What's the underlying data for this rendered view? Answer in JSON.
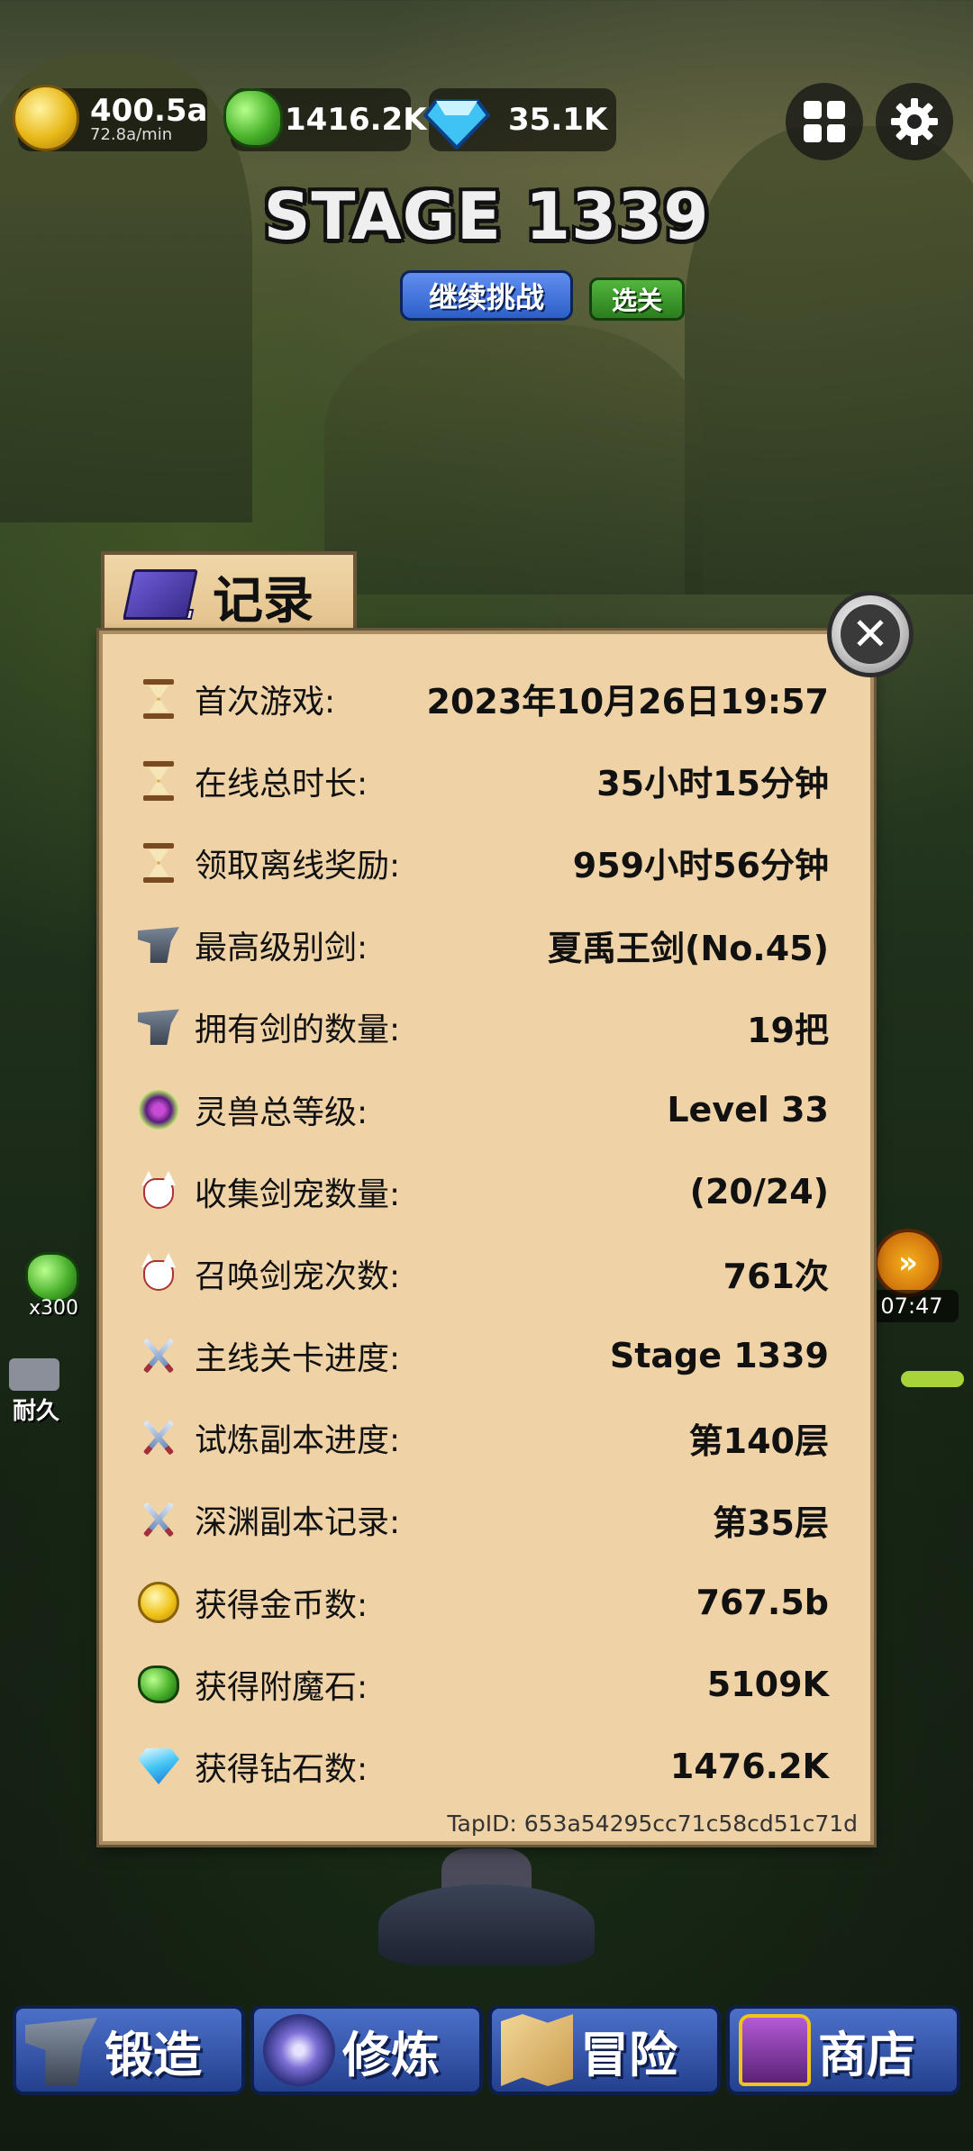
{
  "top_bar": {
    "coins": {
      "value": "400.5a",
      "rate": "72.8a/min",
      "icon": "coin-icon",
      "color": "#e8b818"
    },
    "enchant_stones": {
      "value": "1416.2K",
      "icon": "green-stone-icon",
      "color": "#49b22a"
    },
    "diamonds": {
      "value": "35.1K",
      "icon": "diamond-icon",
      "color": "#3fc3f5"
    },
    "menu_icon": "grid-menu-icon",
    "settings_icon": "gear-icon"
  },
  "stage": {
    "title": "STAGE 1339",
    "continue_label": "继续挑战",
    "select_label": "选关"
  },
  "side_hud": {
    "chip_count": "x300",
    "timer": "07:47",
    "durability_label": "耐久",
    "fast_forward_icon": "fast-forward-icon"
  },
  "record_panel": {
    "title": "记录",
    "rows": [
      {
        "icon": "hourglass-icon",
        "label": "首次游戏:",
        "value": "2023年10月26日19:57"
      },
      {
        "icon": "hourglass-icon",
        "label": "在线总时长:",
        "value": "35小时15分钟"
      },
      {
        "icon": "hourglass-icon",
        "label": "领取离线奖励:",
        "value": "959小时56分钟"
      },
      {
        "icon": "anvil-icon",
        "label": "最高级别剑:",
        "value": "夏禹王剑(No.45)"
      },
      {
        "icon": "anvil-icon",
        "label": "拥有剑的数量:",
        "value": "19把"
      },
      {
        "icon": "spirit-orb-icon",
        "label": "灵兽总等级:",
        "value": "Level 33"
      },
      {
        "icon": "fox-mask-icon",
        "label": "收集剑宠数量:",
        "value": "(20/24)"
      },
      {
        "icon": "fox-mask-icon",
        "label": "召唤剑宠次数:",
        "value": "761次"
      },
      {
        "icon": "crossed-swords-icon",
        "label": "主线关卡进度:",
        "value": "Stage 1339"
      },
      {
        "icon": "crossed-swords-icon",
        "label": "试炼副本进度:",
        "value": "第140层"
      },
      {
        "icon": "crossed-swords-icon",
        "label": "深渊副本记录:",
        "value": "第35层"
      },
      {
        "icon": "coin-icon",
        "label": "获得金币数:",
        "value": "767.5b"
      },
      {
        "icon": "green-stone-icon",
        "label": "获得附魔石:",
        "value": "5109K"
      },
      {
        "icon": "diamond-icon",
        "label": "获得钻石数:",
        "value": "1476.2K"
      }
    ],
    "tap_id": "TapID: 653a54295cc71c58cd51c71d"
  },
  "bottom_nav": [
    {
      "label": "锻造",
      "icon": "anvil-icon"
    },
    {
      "label": "修炼",
      "icon": "spirit-orb-icon"
    },
    {
      "label": "冒险",
      "icon": "map-icon"
    },
    {
      "label": "商店",
      "icon": "treasure-chest-icon"
    }
  ]
}
